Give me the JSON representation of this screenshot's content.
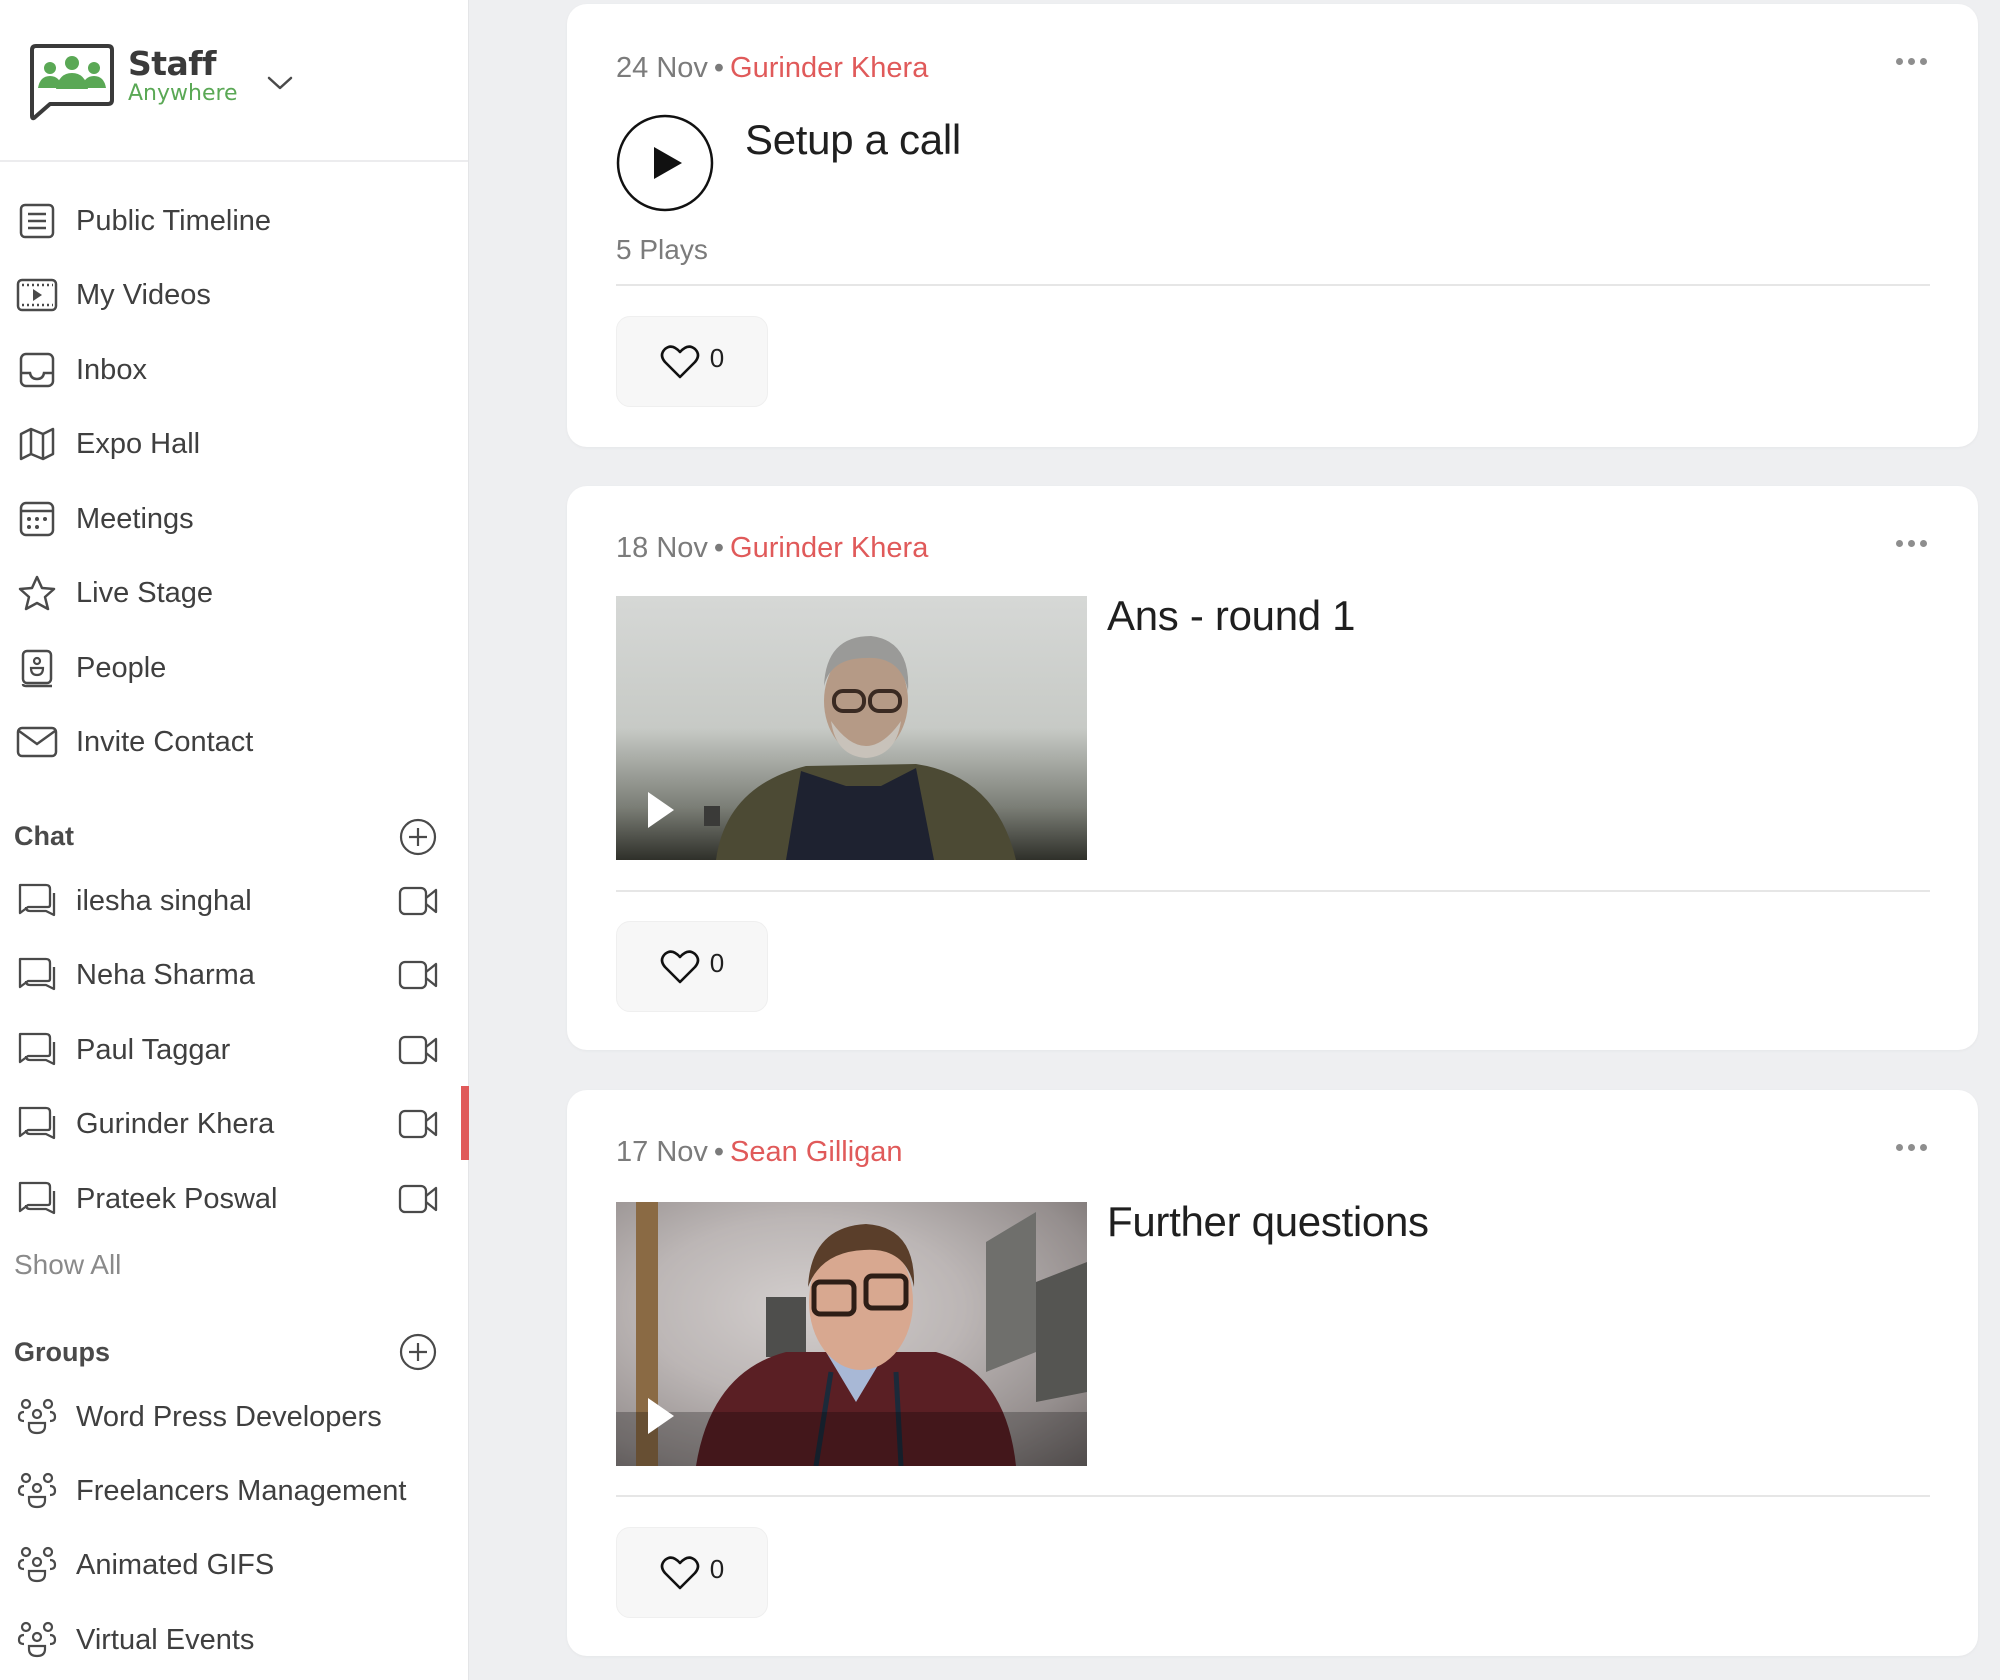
{
  "brand": {
    "name_line1": "Staff",
    "name_line2": "Anywhere",
    "colors": {
      "green": "#5aa855",
      "accent_red": "#e05a5a",
      "text_dark": "#3a3a3a"
    }
  },
  "sidebar": {
    "nav": [
      {
        "label": "Public Timeline",
        "icon": "list-icon"
      },
      {
        "label": "My Videos",
        "icon": "film-icon"
      },
      {
        "label": "Inbox",
        "icon": "inbox-icon"
      },
      {
        "label": "Expo Hall",
        "icon": "map-icon"
      },
      {
        "label": "Meetings",
        "icon": "calendar-icon"
      },
      {
        "label": "Live Stage",
        "icon": "star-icon"
      },
      {
        "label": "People",
        "icon": "contact-book-icon"
      },
      {
        "label": "Invite Contact",
        "icon": "envelope-icon"
      }
    ],
    "chat": {
      "title": "Chat",
      "items": [
        {
          "name": "ilesha singhal"
        },
        {
          "name": "Neha Sharma"
        },
        {
          "name": "Paul Taggar"
        },
        {
          "name": "Gurinder Khera"
        },
        {
          "name": "Prateek Poswal"
        }
      ],
      "show_all": "Show All"
    },
    "groups": {
      "title": "Groups",
      "items": [
        {
          "name": "Word Press Developers"
        },
        {
          "name": "Freelancers Management"
        },
        {
          "name": "Animated GIFS"
        },
        {
          "name": "Virtual Events"
        }
      ]
    }
  },
  "feed": [
    {
      "date": "24 Nov",
      "separator": "•",
      "author": "Gurinder Khera",
      "title": "Setup a call",
      "plays": "5 Plays",
      "likes": "0",
      "media": "audio"
    },
    {
      "date": "18 Nov",
      "separator": "•",
      "author": "Gurinder Khera",
      "title": "Ans - round 1",
      "likes": "0",
      "media": "video"
    },
    {
      "date": "17 Nov",
      "separator": "•",
      "author": "Sean Gilligan",
      "title": "Further questions",
      "likes": "0",
      "media": "video"
    }
  ]
}
